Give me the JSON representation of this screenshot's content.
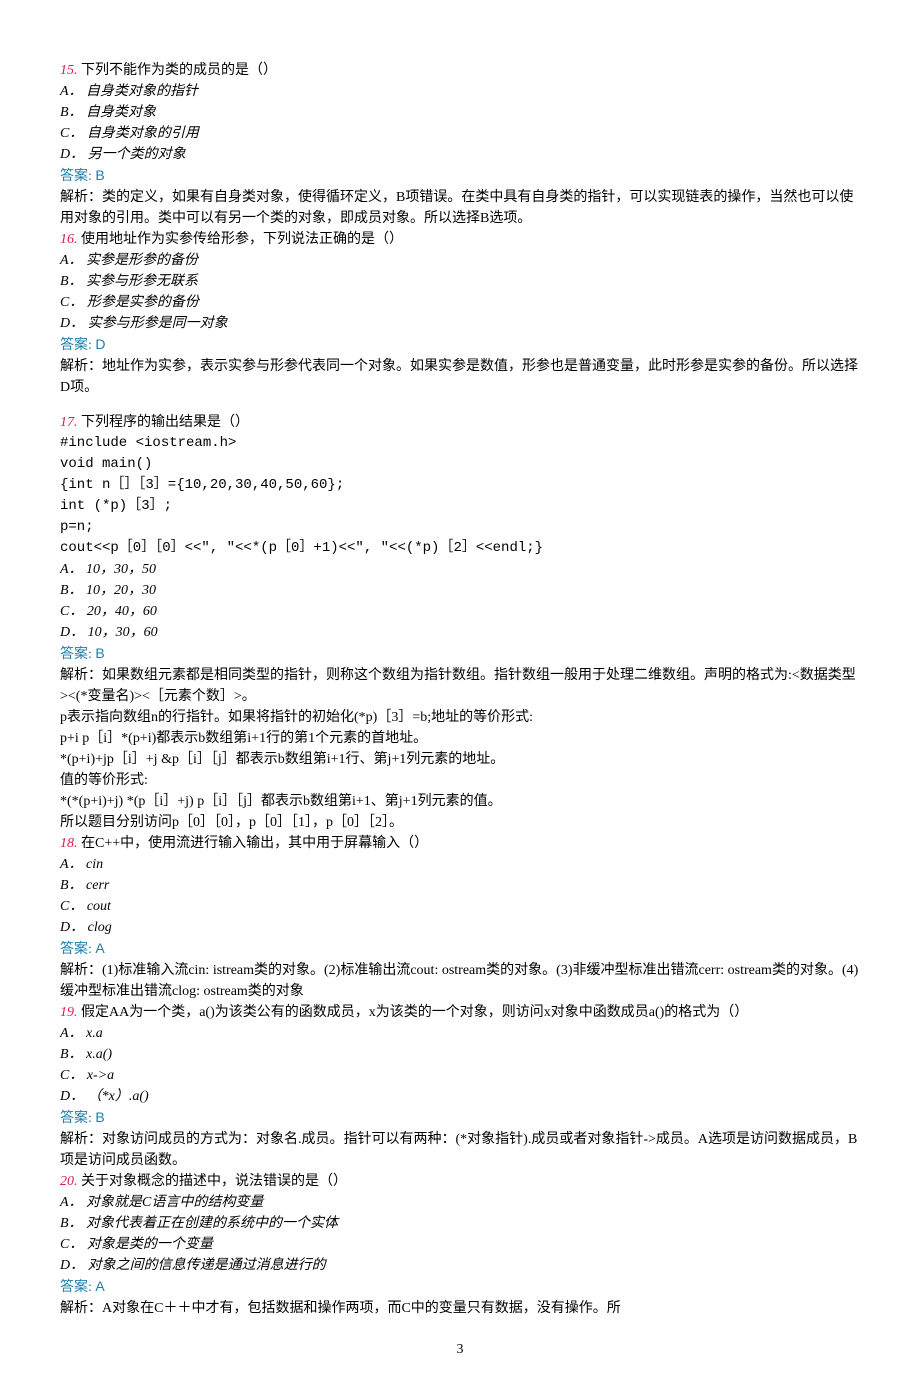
{
  "q15": {
    "num": "15.",
    "text": " 下列不能作为类的成员的是（）",
    "a": "A． 自身类对象的指针",
    "b": "B． 自身类对象",
    "c": "C． 自身类对象的引用",
    "d": "D． 另一个类的对象",
    "ans_label": "答案: ",
    "ans_val": "B",
    "expl": "解析：类的定义，如果有自身类对象，使得循环定义，B项错误。在类中具有自身类的指针，可以实现链表的操作，当然也可以使用对象的引用。类中可以有另一个类的对象，即成员对象。所以选择B选项。"
  },
  "q16": {
    "num": "16.",
    "text": " 使用地址作为实参传给形参，下列说法正确的是（）",
    "a": "A． 实参是形参的备份",
    "b": "B． 实参与形参无联系",
    "c": "C． 形参是实参的备份",
    "d": "D． 实参与形参是同一对象",
    "ans_label": "答案: ",
    "ans_val": "D",
    "expl": "解析：地址作为实参，表示实参与形参代表同一个对象。如果实参是数值，形参也是普通变量，此时形参是实参的备份。所以选择D项。"
  },
  "q17": {
    "num": "17.",
    "text": " 下列程序的输出结果是（）",
    "code1": "#include <iostream.h>",
    "code2": "void main()",
    "code3": "{int n［］［3］={10,20,30,40,50,60};",
    "code4": "int (*p)［3］;",
    "code5": "p=n;",
    "code6": "cout<<p［0］［0］<<\", \"<<*(p［0］+1)<<\", \"<<(*p)［2］<<endl;}",
    "a": "A． 10，30，50",
    "b": "B． 10，20，30",
    "c": "C． 20，40，60",
    "d": "D． 10，30，60",
    "ans_label": "答案: ",
    "ans_val": "B",
    "expl1": "解析：如果数组元素都是相同类型的指针，则称这个数组为指针数组。指针数组一般用于处理二维数组。声明的格式为:<数据类型><(*变量名)><［元素个数］>。",
    "expl2": "p表示指向数组n的行指针。如果将指针的初始化(*p)［3］=b;地址的等价形式:",
    "expl3": "p+i p［i］*(p+i)都表示b数组第i+1行的第1个元素的首地址。",
    "expl4": "*(p+i)+jp［i］+j &p［i］［j］都表示b数组第i+1行、第j+1列元素的地址。",
    "expl5": "值的等价形式:",
    "expl6": "*(*(p+i)+j) *(p［i］+j) p［i］［j］都表示b数组第i+1、第j+1列元素的值。",
    "expl7": "所以题目分别访问p［0］［0］，p［0］［1］，p［0］［2］。"
  },
  "q18": {
    "num": "18.",
    "text": " 在C++中，使用流进行输入输出，其中用于屏幕输入（）",
    "a": "A． cin",
    "b": "B． cerr",
    "c": "C． cout",
    "d": "D． clog",
    "ans_label": "答案: ",
    "ans_val": "A",
    "expl": "解析：(1)标准输入流cin: istream类的对象。(2)标准输出流cout: ostream类的对象。(3)非缓冲型标准出错流cerr: ostream类的对象。(4)缓冲型标准出错流clog: ostream类的对象"
  },
  "q19": {
    "num": "19.",
    "text": " 假定AA为一个类，a()为该类公有的函数成员，x为该类的一个对象，则访问x对象中函数成员a()的格式为（）",
    "a": "A． x.a",
    "b": "B． x.a()",
    "c": "C． x->a",
    "d": "D． （*x）.a()",
    "ans_label": "答案: ",
    "ans_val": "B",
    "expl": "解析：对象访问成员的方式为：对象名.成员。指针可以有两种：(*对象指针).成员或者对象指针->成员。A选项是访问数据成员，B项是访问成员函数。"
  },
  "q20": {
    "num": "20.",
    "text": " 关于对象概念的描述中，说法错误的是（）",
    "a": "A． 对象就是C语言中的结构变量",
    "b": "B． 对象代表着正在创建的系统中的一个实体",
    "c": "C． 对象是类的一个变量",
    "d": "D． 对象之间的信息传递是通过消息进行的",
    "ans_label": "答案: ",
    "ans_val": "A",
    "expl": "解析：A对象在C＋＋中才有，包括数据和操作两项，而C中的变量只有数据，没有操作。所"
  },
  "page": "3"
}
